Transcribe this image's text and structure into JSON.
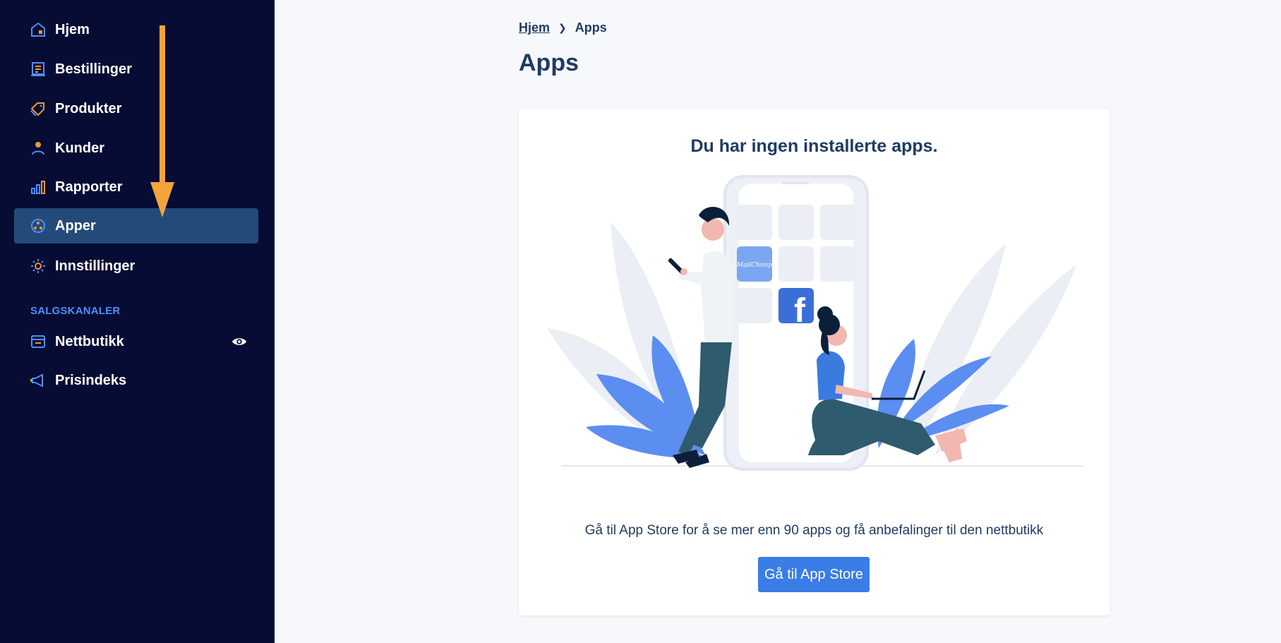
{
  "sidebar": {
    "items": [
      {
        "label": "Hjem",
        "icon": "home-icon"
      },
      {
        "label": "Bestillinger",
        "icon": "orders-icon"
      },
      {
        "label": "Produkter",
        "icon": "tag-icon"
      },
      {
        "label": "Kunder",
        "icon": "person-icon"
      },
      {
        "label": "Rapporter",
        "icon": "bar-chart-icon"
      },
      {
        "label": "Apper",
        "icon": "apps-icon",
        "active": true
      },
      {
        "label": "Innstillinger",
        "icon": "gear-icon"
      }
    ],
    "section_title": "SALGSKANALER",
    "channels": [
      {
        "label": "Nettbutikk",
        "icon": "storefront-icon",
        "action_icon": "eye-icon"
      },
      {
        "label": "Prisindeks",
        "icon": "megaphone-icon"
      }
    ]
  },
  "breadcrumb": {
    "home": "Hjem",
    "current": "Apps"
  },
  "page_title": "Apps",
  "empty_state": {
    "heading": "Du har ingen installerte apps.",
    "description": "Gå til App Store for å se mer enn 90 apps og få anbefalinger til den nettbutikk",
    "button_label": "Gå til App Store"
  },
  "colors": {
    "sidebar_bg": "#060c33",
    "active_item_bg": "#244a7a",
    "accent": "#3a7de6",
    "icon_orange": "#f5962f",
    "annotation_arrow": "#f5a33a",
    "text_dark": "#1f3b63"
  }
}
